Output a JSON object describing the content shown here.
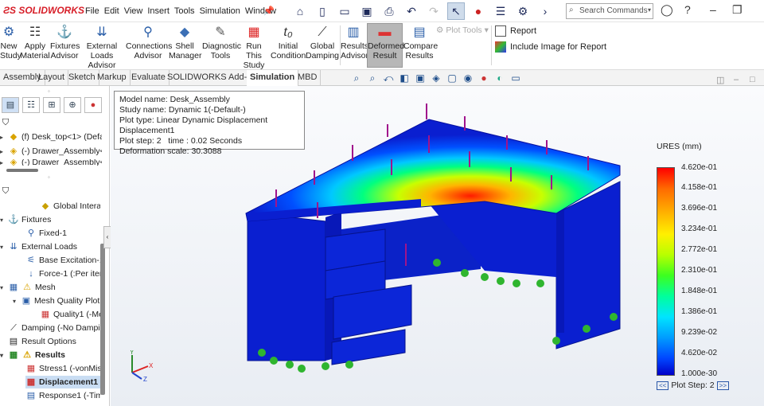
{
  "app": {
    "brand": "SOLIDWORKS"
  },
  "menu": [
    "File",
    "Edit",
    "View",
    "Insert",
    "Tools",
    "Simulation",
    "Window"
  ],
  "search": {
    "placeholder": "Search Commands"
  },
  "ribbon": {
    "buttons": [
      {
        "label": "New Study"
      },
      {
        "label": "Apply Material"
      },
      {
        "label": "Fixtures Advisor"
      },
      {
        "label": "External Loads Advisor"
      },
      {
        "label": "Connections Advisor"
      },
      {
        "label": "Shell Manager"
      },
      {
        "label": "Diagnostic Tools"
      },
      {
        "label": "Run This Study"
      },
      {
        "label": "Initial Condition"
      },
      {
        "label": "Global Damping"
      },
      {
        "label": "Results Advisor"
      },
      {
        "label": "Deformed Result"
      },
      {
        "label": "Compare Results"
      },
      {
        "label": "Plot Tools"
      }
    ],
    "report": "Report",
    "include_image": "Include Image for Report"
  },
  "tabs": [
    "Assembly",
    "Layout",
    "Sketch",
    "Markup",
    "Evaluate",
    "SOLIDWORKS Add-Ins",
    "Simulation",
    "MBD"
  ],
  "active_tab": "Simulation",
  "tree_top": [
    {
      "label": "(f) Desk_top<1> (Defa"
    },
    {
      "label": "(-) Drawer_Assembly<"
    },
    {
      "label": "(-) Drawer_Assembly<"
    }
  ],
  "tree_sim": [
    {
      "label": "Global Intera"
    },
    {
      "label": "Fixtures"
    },
    {
      "label": "Fixed-1"
    },
    {
      "label": "External Loads"
    },
    {
      "label": "Base Excitation-1"
    },
    {
      "label": "Force-1 (:Per item"
    },
    {
      "label": "Mesh"
    },
    {
      "label": "Mesh Quality Plot"
    },
    {
      "label": "Quality1 (-Me"
    },
    {
      "label": "Damping (-No Dampi"
    },
    {
      "label": "Result Options"
    },
    {
      "label": "Results"
    },
    {
      "label": "Stress1 (-vonMise"
    },
    {
      "label": "Displacement1 ("
    },
    {
      "label": "Response1 (-Time"
    }
  ],
  "plot_info": {
    "model": "Model name: Desk_Assembly",
    "study": "Study name: Dynamic 1(-Default-)",
    "type": "Plot type: Linear Dynamic Displacement Displacement1",
    "step": "Plot step: 2   time : 0.02 Seconds",
    "scale": "Deformation scale: 30.3088"
  },
  "legend": {
    "title": "URES (mm)",
    "labels": [
      "4.620e-01",
      "4.158e-01",
      "3.696e-01",
      "3.234e-01",
      "2.772e-01",
      "2.310e-01",
      "1.848e-01",
      "1.386e-01",
      "9.239e-02",
      "4.620e-02",
      "1.000e-30"
    ],
    "plot_step": "Plot Step: 2",
    "prev": "<<",
    "next": ">>"
  },
  "triad": {
    "x": "X",
    "y": "Y",
    "z": "Z"
  },
  "colors": {
    "active_tab": "#ffffff",
    "brand": "#d71e28",
    "model_blue": "#0a1fd0"
  }
}
